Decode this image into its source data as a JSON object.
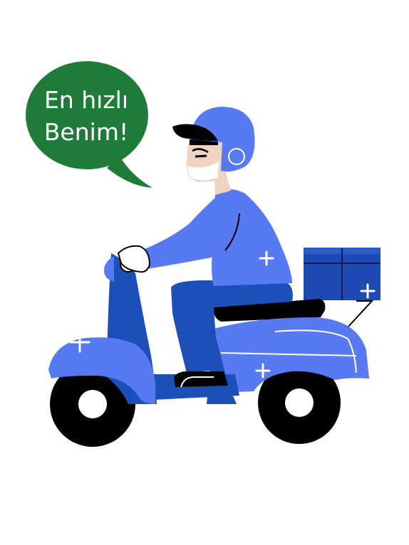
{
  "speech_bubble": {
    "line1": "En hızlı",
    "line2": "Benim!"
  },
  "colors": {
    "bubble_green": "#1E7B3A",
    "scooter_blue": "#1D4FB9",
    "light_blue": "#5779F1",
    "box_blue": "#1F4AB3",
    "skin": "#F0D3C0",
    "black": "#000000",
    "white": "#FFFFFF"
  },
  "icons": [
    "plus-icon",
    "plus-icon",
    "plus-icon",
    "plus-icon"
  ]
}
